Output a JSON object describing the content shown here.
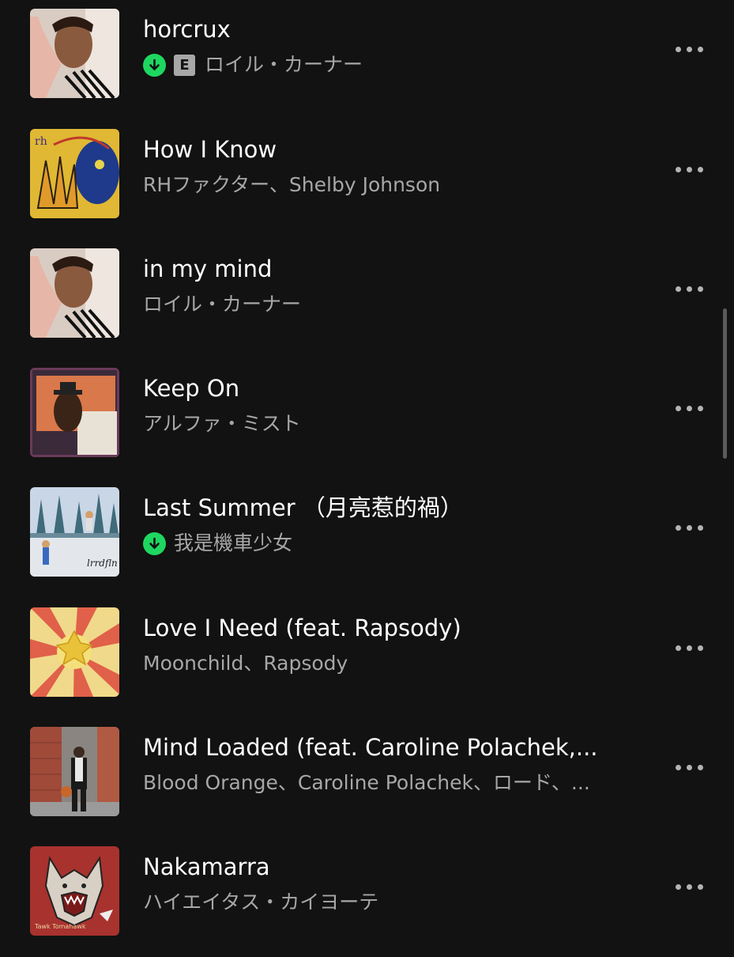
{
  "tracks": [
    {
      "title": "horcrux",
      "artist": "ロイル・カーナー",
      "downloaded": true,
      "explicit": true,
      "explicit_label": "E",
      "art": "portrait-pink-striped"
    },
    {
      "title": "How I Know",
      "artist": "RHファクター、Shelby Johnson",
      "downloaded": false,
      "explicit": false,
      "art": "yellow-blue-face-hand"
    },
    {
      "title": "in my mind",
      "artist": "ロイル・カーナー",
      "downloaded": false,
      "explicit": false,
      "art": "portrait-pink-striped"
    },
    {
      "title": "Keep On",
      "artist": "アルファ・ミスト",
      "downloaded": false,
      "explicit": false,
      "art": "orange-collage-hat"
    },
    {
      "title": "Last Summer （月亮惹的禍）",
      "artist": "我是機車少女",
      "downloaded": true,
      "explicit": false,
      "art": "trees-pool-jump"
    },
    {
      "title": "Love I Need (feat. Rapsody)",
      "artist": "Moonchild、Rapsody",
      "downloaded": false,
      "explicit": false,
      "art": "sunburst-yellow-red"
    },
    {
      "title": "Mind Loaded (feat. Caroline Polachek,...",
      "artist": "Blood Orange、Caroline Polachek、ロード、...",
      "downloaded": false,
      "explicit": false,
      "art": "street-person-basketball"
    },
    {
      "title": "Nakamarra",
      "artist": "ハイエイタス・カイヨーテ",
      "downloaded": false,
      "explicit": false,
      "art": "red-wolf-illustration"
    }
  ],
  "colors": {
    "background": "#121212",
    "title": "#ffffff",
    "subtitle": "#a7a7a7",
    "download": "#1ed760"
  },
  "icons": {
    "download": "arrow-down-circle-icon",
    "more": "more-horizontal-icon",
    "explicit": "explicit-badge"
  }
}
